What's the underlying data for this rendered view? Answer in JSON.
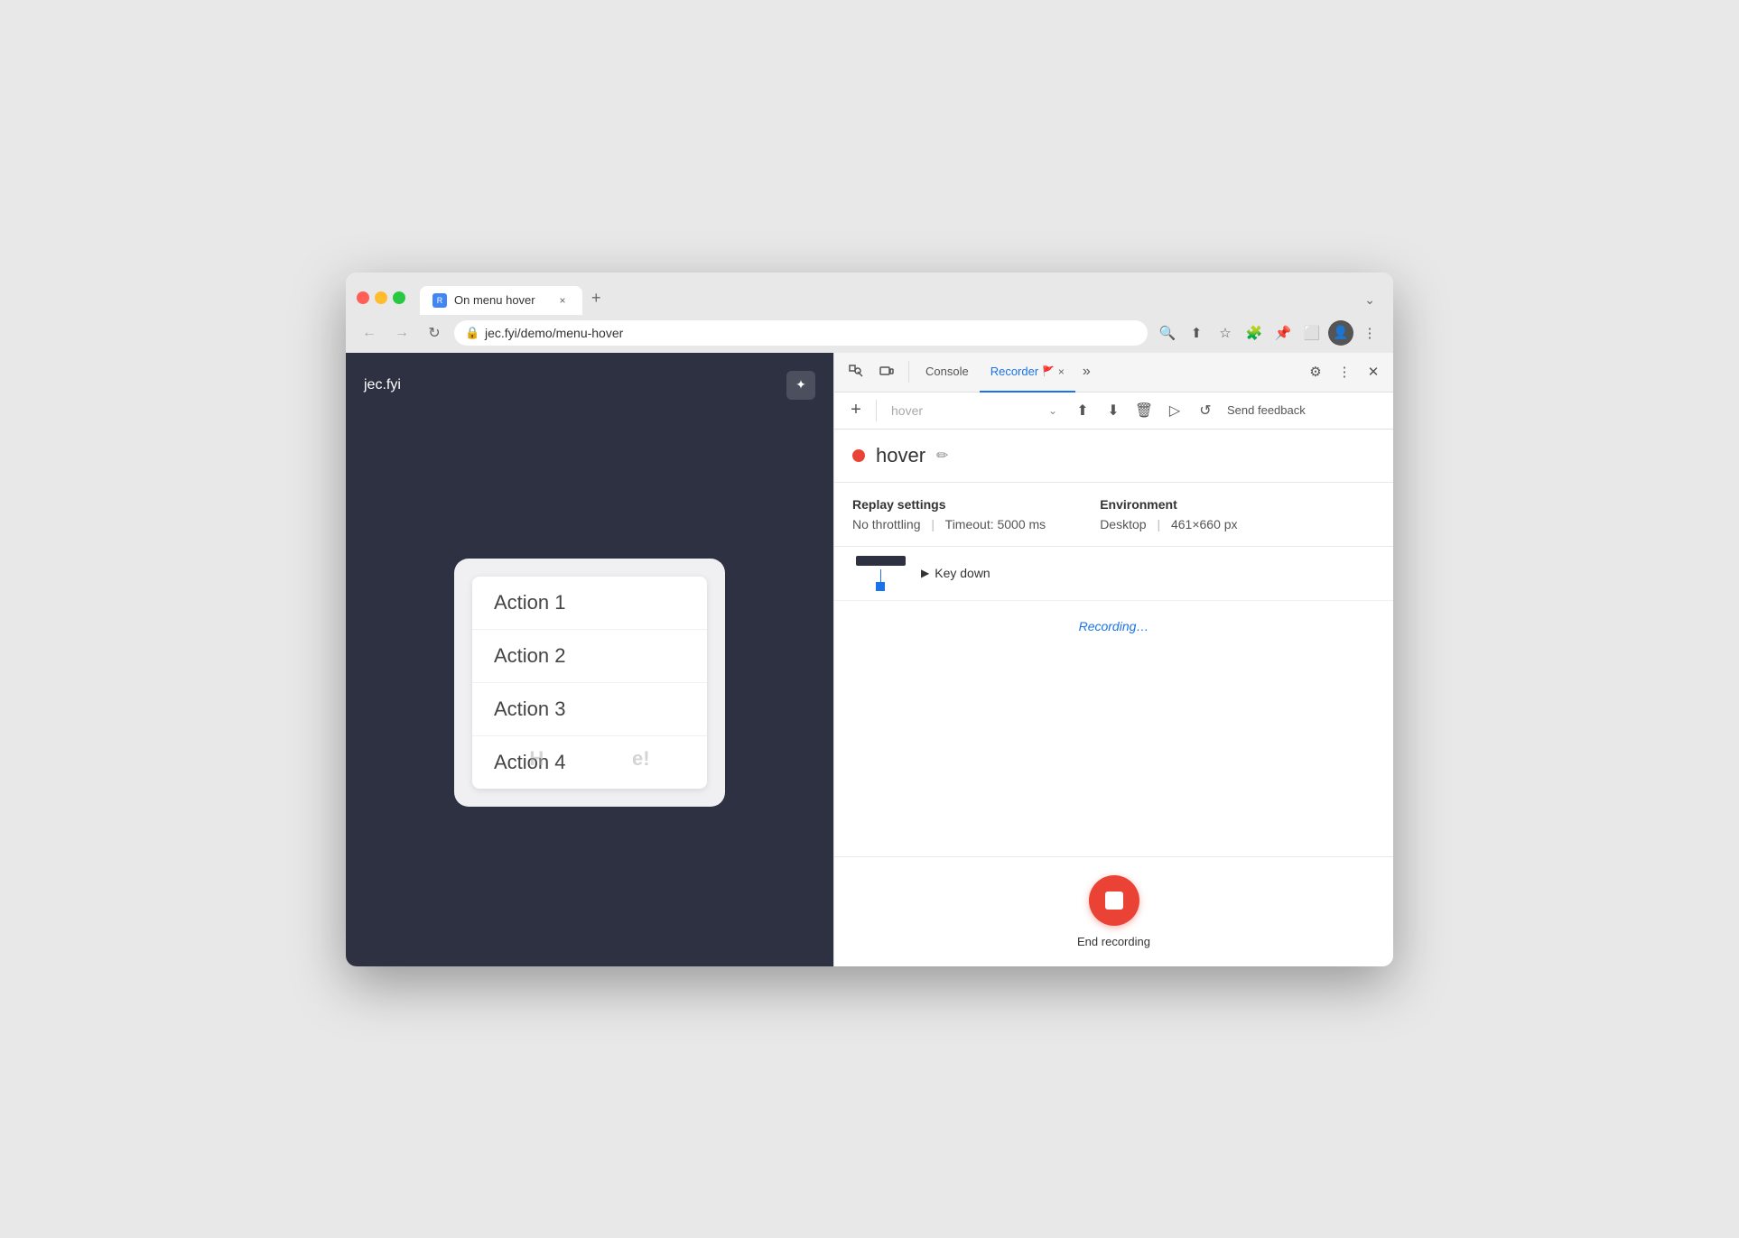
{
  "browser": {
    "title": "On menu hover",
    "url": "jec.fyi/demo/menu-hover",
    "favicon_label": "R",
    "tab_close_label": "×",
    "new_tab_label": "+",
    "chevron_label": "⌄"
  },
  "nav": {
    "back_icon": "←",
    "forward_icon": "→",
    "refresh_icon": "↻",
    "lock_icon": "🔒",
    "search_icon": "🔍",
    "share_icon": "↑",
    "bookmark_icon": "☆",
    "extension_icon": "🧩",
    "pin_icon": "📌",
    "split_icon": "⬜",
    "profile_icon": "👤",
    "more_icon": "⋮"
  },
  "page": {
    "logo": "jec.fyi",
    "theme_icon": "✦",
    "menu_items": [
      "Action 1",
      "Action 2",
      "Action 3",
      "Action 4"
    ],
    "page_text": "Hover me!"
  },
  "devtools": {
    "inspect_icon": "⬚",
    "device_icon": "⬜",
    "console_tab": "Console",
    "recorder_tab": "Recorder",
    "recorder_badge": "🚩",
    "recorder_close": "×",
    "more_icon": "»",
    "settings_icon": "⚙",
    "more_options_icon": "⋮",
    "close_icon": "✕"
  },
  "recorder": {
    "add_icon": "+",
    "select_placeholder": "hover",
    "chevron_icon": "⌄",
    "export_icon": "↑",
    "import_icon": "↓",
    "delete_icon": "🗑",
    "replay_icon": "▷",
    "slow_replay_icon": "↺",
    "send_feedback": "Send feedback",
    "recording_dot_color": "#ea4335",
    "recording_name": "hover",
    "edit_icon": "✏",
    "replay_settings_label": "Replay settings",
    "throttling_label": "No throttling",
    "timeout_label": "Timeout: 5000 ms",
    "environment_label": "Environment",
    "desktop_label": "Desktop",
    "dimensions_label": "461×660 px",
    "step_key_down": "Key down",
    "recording_status": "Recording…",
    "end_recording_label": "End recording"
  }
}
